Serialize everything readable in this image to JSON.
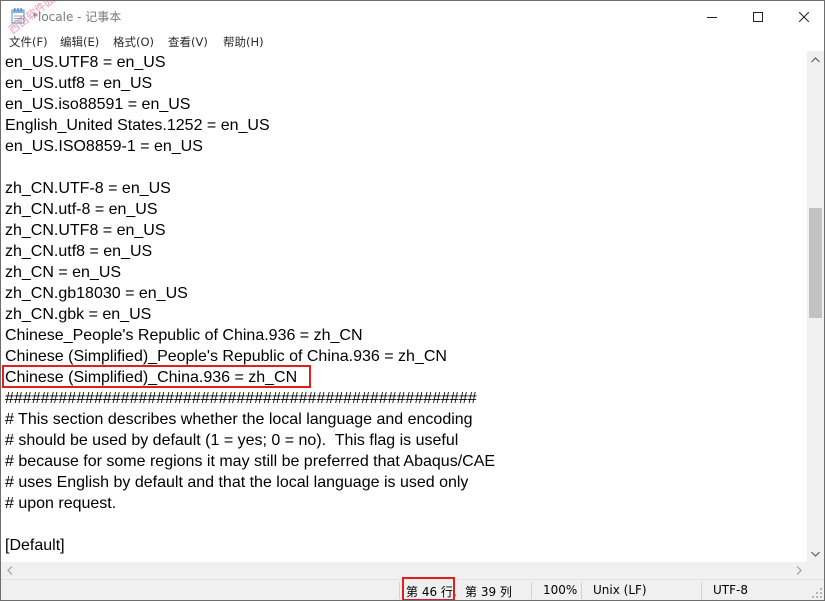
{
  "window": {
    "title": "*locale - 记事本",
    "icon": "notepad-icon"
  },
  "watermark": "西西软件园",
  "menu": [
    {
      "label": "文件(F)"
    },
    {
      "label": "编辑(E)"
    },
    {
      "label": "格式(O)"
    },
    {
      "label": "查看(V)"
    },
    {
      "label": "帮助(H)"
    }
  ],
  "editor": {
    "lines": [
      "en_US.UTF8 = en_US",
      "en_US.utf8 = en_US",
      "en_US.iso88591 = en_US",
      "English_United States.1252 = en_US",
      "en_US.ISO8859-1 = en_US",
      "",
      "zh_CN.UTF-8 = en_US",
      "zh_CN.utf-8 = en_US",
      "zh_CN.UTF8 = en_US",
      "zh_CN.utf8 = en_US",
      "zh_CN = en_US",
      "zh_CN.gb18030 = en_US",
      "zh_CN.gbk = en_US",
      "Chinese_People's Republic of China.936 = zh_CN",
      "Chinese (Simplified)_People's Republic of China.936 = zh_CN",
      "Chinese (Simplified)_China.936 = zh_CN",
      "#####################################################",
      "# This section describes whether the local language and encoding",
      "# should be used by default (1 = yes; 0 = no).  This flag is useful",
      "# because for some regions it may still be preferred that Abaqus/CAE",
      "# uses English by default and that the local language is used only",
      "# upon request.",
      "",
      "[Default]"
    ],
    "highlight_color": "#e0201c"
  },
  "status": {
    "line": "第 46 行,",
    "column": "第 39 列",
    "zoom": "100%",
    "line_ending": "Unix (LF)",
    "encoding": "UTF-8"
  }
}
